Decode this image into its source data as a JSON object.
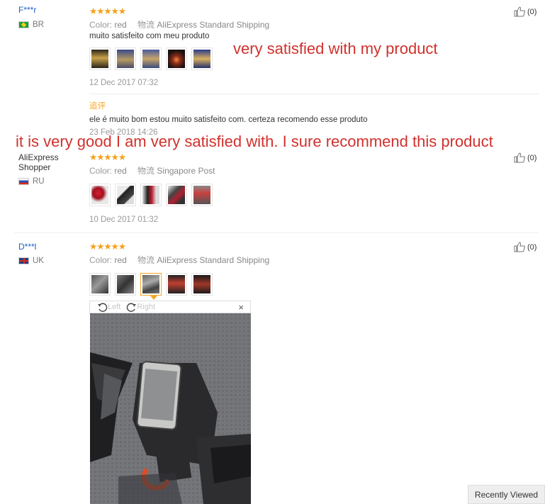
{
  "reviews": [
    {
      "user": "F***r",
      "country": "BR",
      "rating": "★★★★★",
      "color_label": "Color:",
      "color_value": "red",
      "shipping_label": "物流",
      "shipping_value": "AliExpress Standard Shipping",
      "text": "muito satisfeito com meu produto",
      "date": "12 Dec 2017 07:32",
      "additional_label": "追评",
      "additional_text": "ele é muito bom estou muito satisfeito com. certeza recomendo esse produto",
      "additional_date": "23 Feb 2018 14:26",
      "likes": "(0)"
    },
    {
      "user_line1": "AliExpress",
      "user_line2": "Shopper",
      "country": "RU",
      "rating": "★★★★★",
      "color_label": "Color:",
      "color_value": "red",
      "shipping_label": "物流",
      "shipping_value": "Singapore Post",
      "date": "10 Dec 2017 01:32",
      "likes": "(0)"
    },
    {
      "user": "D***l",
      "country": "UK",
      "rating": "★★★★★",
      "color_label": "Color:",
      "color_value": "red",
      "shipping_label": "物流",
      "shipping_value": "AliExpress Standard Shipping",
      "likes": "(0)"
    }
  ],
  "overlays": {
    "translation_1": "very satisfied with my product",
    "translation_2": "it is very good I am very satisfied with. I sure recommend this product"
  },
  "viewer": {
    "rotate_left": "Left",
    "rotate_right": "Right",
    "close": "×"
  },
  "recently_viewed": "Recently Viewed",
  "colors": {
    "link_blue": "#1a61c3",
    "star_orange": "#f6a01a",
    "overlay_red": "#d0312d"
  }
}
